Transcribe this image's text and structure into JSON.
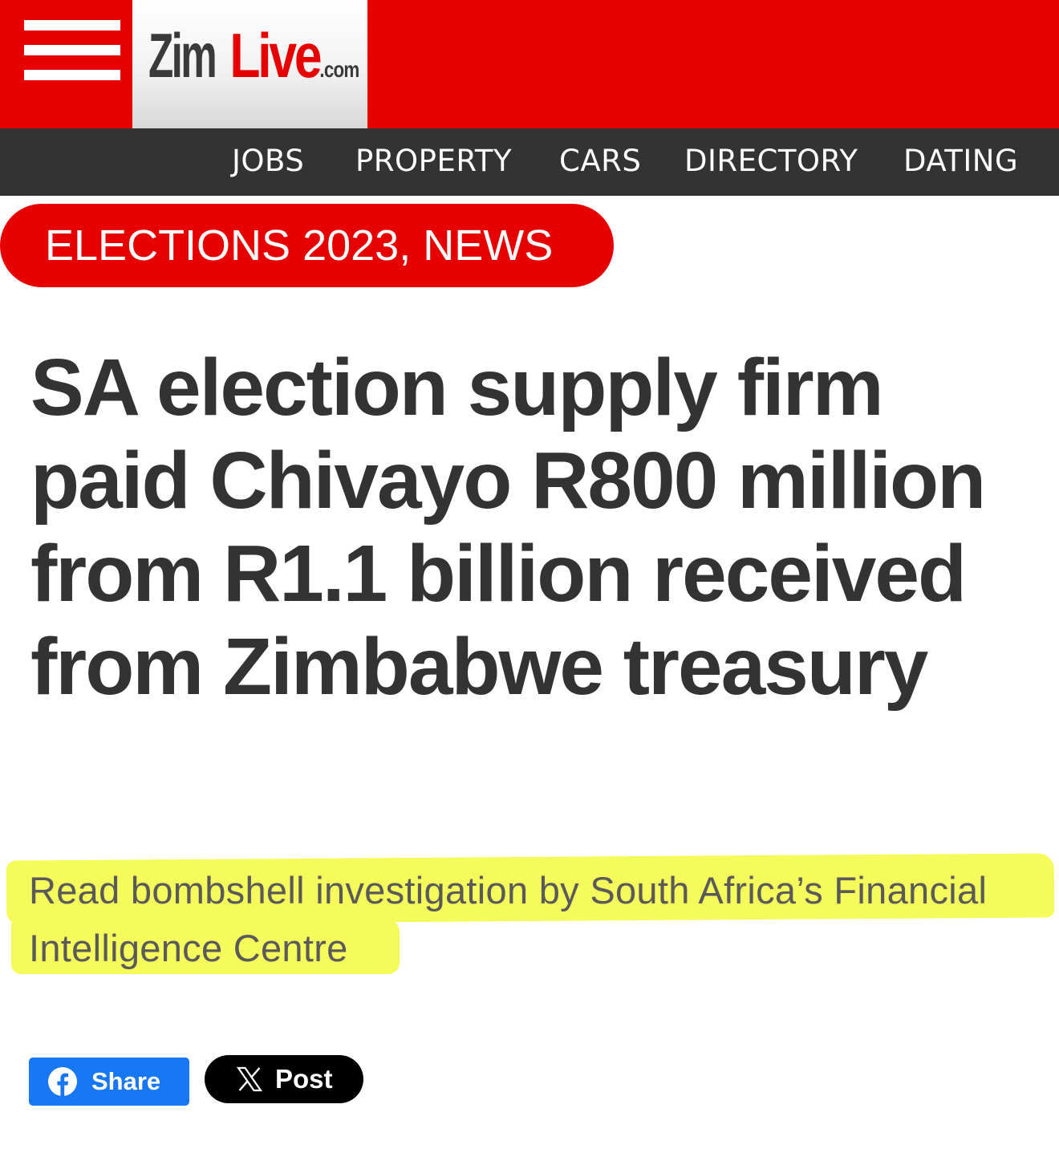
{
  "header": {
    "menu_icon": "hamburger-menu-icon",
    "logo": {
      "primary": "Zim",
      "accent": "Live",
      "suffix": ".com"
    },
    "brand_color": "#e60000"
  },
  "nav": {
    "items": [
      {
        "label": "JOBS"
      },
      {
        "label": "PROPERTY"
      },
      {
        "label": "CARS"
      },
      {
        "label": "DIRECTORY"
      },
      {
        "label": "DATING"
      }
    ],
    "background": "#333333"
  },
  "article": {
    "category": "ELECTIONS 2023, NEWS",
    "headline": "SA election supply firm paid Chivayo R800 million from R1.1 billion received from Zimbabwe treasury",
    "subheading": "Read bombshell investigation by South Africa’s Financial Intelligence Centre",
    "highlight_color": "#f4fb5a"
  },
  "share": {
    "facebook": {
      "label": "Share",
      "icon": "facebook-icon",
      "color": "#1877f2"
    },
    "x": {
      "label": "Post",
      "icon": "x-logo-icon",
      "color": "#000000"
    }
  }
}
